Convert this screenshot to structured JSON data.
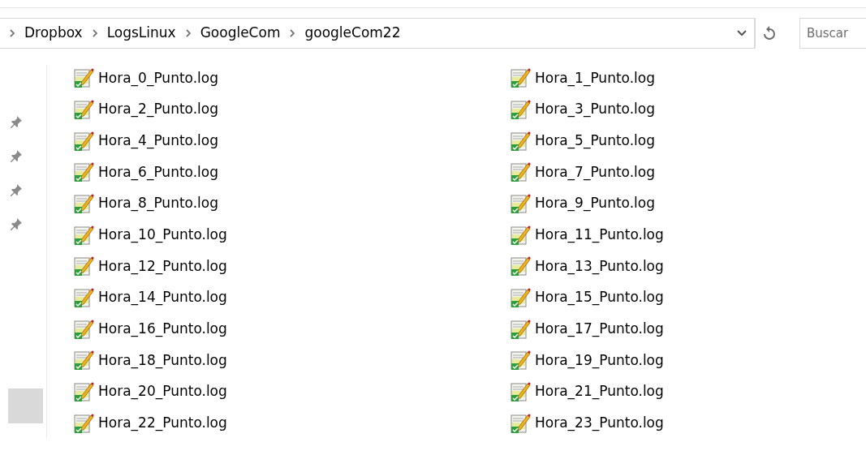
{
  "address_bar": {
    "path": [
      "Dropbox",
      "LogsLinux",
      "GoogleCom",
      "googleCom22"
    ]
  },
  "search": {
    "placeholder": "Buscar"
  },
  "files": [
    "Hora_0_Punto.log",
    "Hora_1_Punto.log",
    "Hora_2_Punto.log",
    "Hora_3_Punto.log",
    "Hora_4_Punto.log",
    "Hora_5_Punto.log",
    "Hora_6_Punto.log",
    "Hora_7_Punto.log",
    "Hora_8_Punto.log",
    "Hora_9_Punto.log",
    "Hora_10_Punto.log",
    "Hora_11_Punto.log",
    "Hora_12_Punto.log",
    "Hora_13_Punto.log",
    "Hora_14_Punto.log",
    "Hora_15_Punto.log",
    "Hora_16_Punto.log",
    "Hora_17_Punto.log",
    "Hora_18_Punto.log",
    "Hora_19_Punto.log",
    "Hora_20_Punto.log",
    "Hora_21_Punto.log",
    "Hora_22_Punto.log",
    "Hora_23_Punto.log"
  ]
}
